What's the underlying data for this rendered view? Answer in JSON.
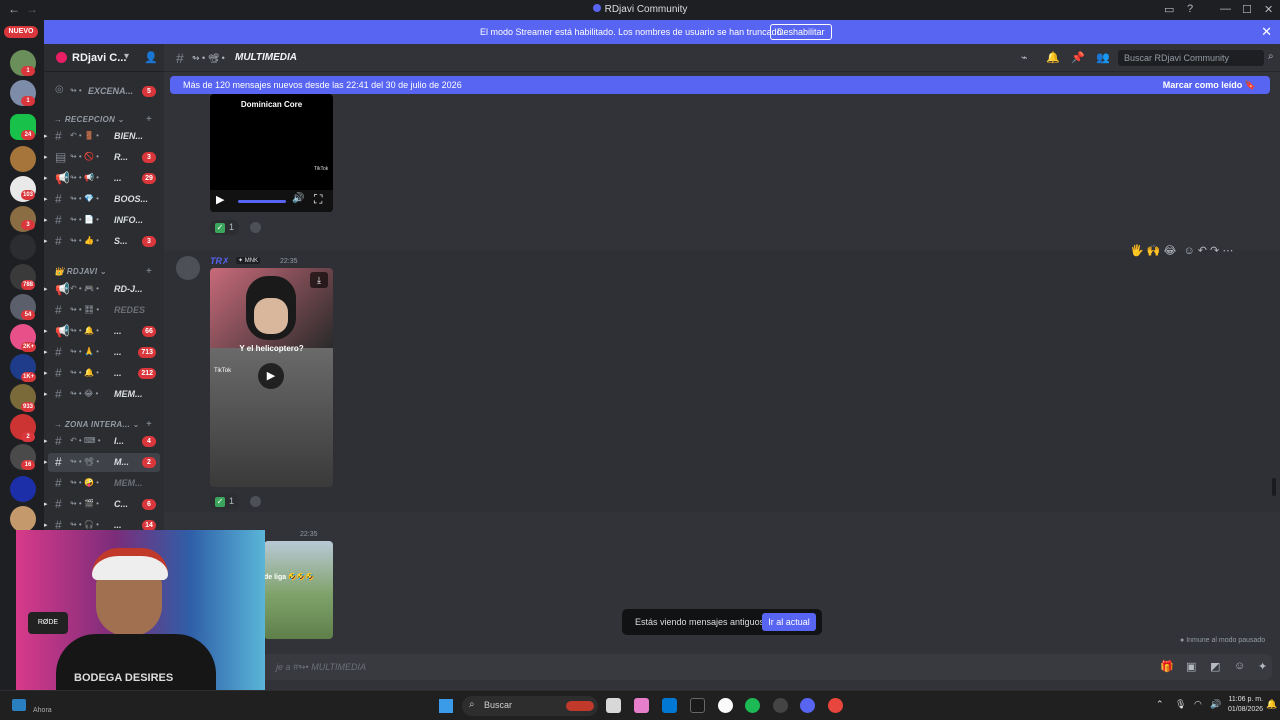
{
  "window": {
    "title": "RDjavi Community",
    "minimize": "—",
    "maximize": "☐",
    "close": "✕"
  },
  "streamer_banner": {
    "message": "El modo Streamer está habilitado. Los nombres de usuario se han truncado.",
    "button": "Deshabilitar"
  },
  "rail": {
    "nuevo": "NUEVO",
    "badges": [
      "1",
      "1",
      "24",
      "103",
      "3",
      "788",
      "54",
      "2K+",
      "1K+",
      "933",
      "2",
      "16"
    ]
  },
  "server": {
    "name": "RDjavi C..."
  },
  "sidebar": {
    "top_channel": {
      "label": "EXCENA...",
      "badge": "5"
    },
    "categories": [
      {
        "name": "RECEPCION",
        "channels": [
          {
            "label": "BIEN...",
            "badge": ""
          },
          {
            "label": "R...",
            "badge": "3"
          },
          {
            "label": "...",
            "badge": "29"
          },
          {
            "label": "BOOS...",
            "badge": ""
          },
          {
            "label": "INFO...",
            "badge": ""
          },
          {
            "label": "S...",
            "badge": "3"
          }
        ]
      },
      {
        "name": "RDJAVI",
        "channels": [
          {
            "label": "RD-J...",
            "badge": ""
          },
          {
            "label": "REDES",
            "badge": ""
          },
          {
            "label": "...",
            "badge": "66"
          },
          {
            "label": "...",
            "badge": "713"
          },
          {
            "label": "...",
            "badge": "212"
          },
          {
            "label": "MEM...",
            "badge": ""
          }
        ]
      },
      {
        "name": "ZONA INTERA...",
        "channels": [
          {
            "label": "I...",
            "badge": "4"
          },
          {
            "label": "M...",
            "badge": "2"
          },
          {
            "label": "MEM...",
            "badge": ""
          },
          {
            "label": "C...",
            "badge": "6"
          },
          {
            "label": "...",
            "badge": "14"
          }
        ]
      }
    ]
  },
  "channel_header": {
    "name": "MULTIMEDIA",
    "search_placeholder": "Buscar RDjavi Community"
  },
  "new_messages_bar": {
    "text": "Más de 120 mensajes nuevos desde las 22:41 del 30 de julio de 2026",
    "action": "Marcar como leído"
  },
  "messages": [
    {
      "video_caption": "Dominican Core",
      "video_watermark": "TikTok",
      "reaction_count": "1"
    },
    {
      "author": "TR✗",
      "tag": "MNK",
      "time": "22:35",
      "video_caption": "Y el helicoptero?",
      "video_watermark": "TikTok",
      "reaction_count": "1"
    },
    {
      "time": "22:35",
      "video_caption": "de liga 🤣🤣🤣"
    }
  ],
  "old_messages_banner": {
    "text": "Estás viendo mensajes antiguos",
    "button": "Ir al actual"
  },
  "immune_text": "Inmune al modo pausado",
  "composer": {
    "placeholder": "je a #↬•  MULTIMEDIA"
  },
  "webcam": {
    "shirt_text": "BODEGA DESIRES",
    "mic_label": "RØDE"
  },
  "taskbar": {
    "search": "Buscar",
    "ahora": "Ahora",
    "time": "11:06 p. m.",
    "date": "01/08/2026"
  },
  "colors": {
    "blurple": "#5865f2",
    "badge_red": "#da373c",
    "bg_main": "#313338",
    "bg_sidebar": "#2b2d31",
    "bg_rail": "#1e1f22"
  }
}
